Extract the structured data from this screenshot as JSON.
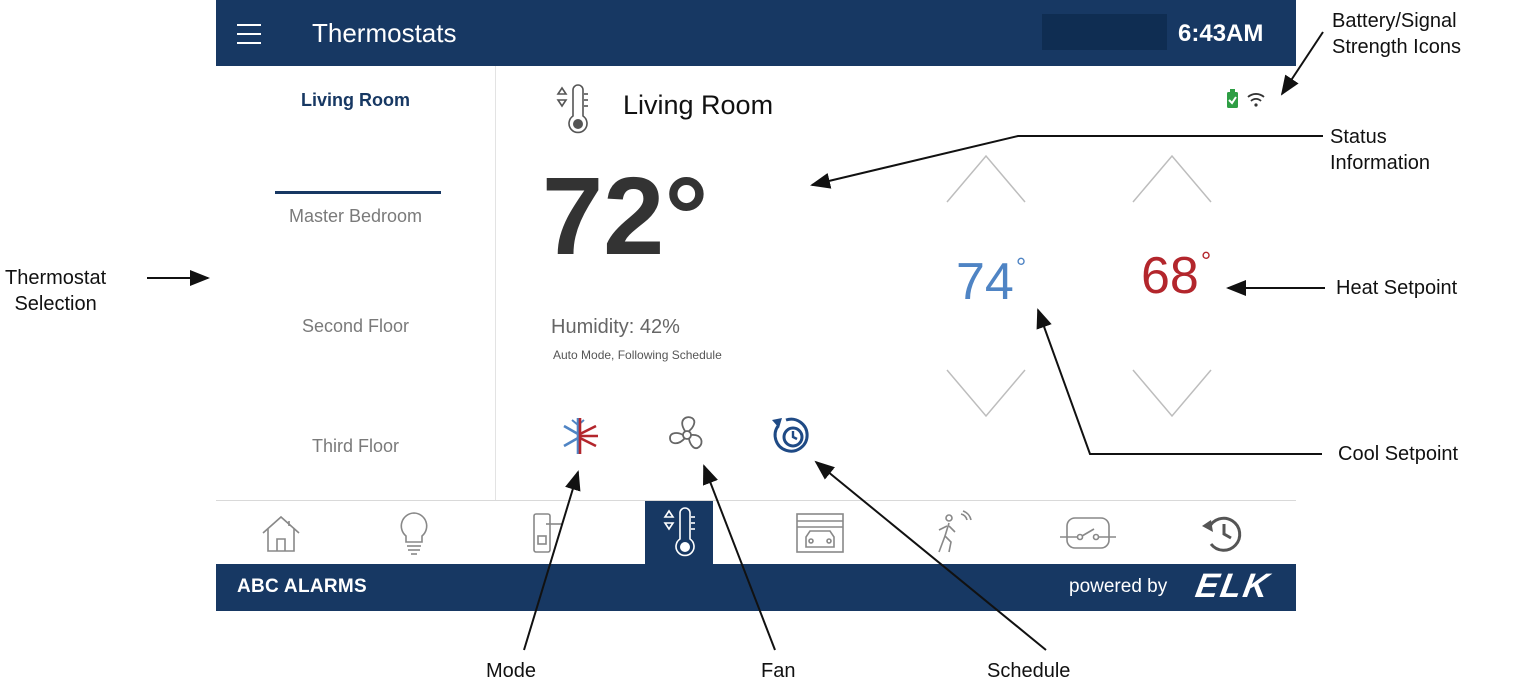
{
  "header": {
    "title": "Thermostats",
    "time": "6:43AM"
  },
  "thermostats": [
    "Living Room",
    "Master Bedroom",
    "Second Floor",
    "Third Floor"
  ],
  "zone": {
    "name": "Living Room",
    "temperature": "72°",
    "humidity": "Humidity: 42%",
    "mode_line": "Auto Mode, Following Schedule",
    "cool_setpoint": "74",
    "heat_setpoint": "68",
    "degree_symbol": "°"
  },
  "status_icons": [
    "battery-icon",
    "wifi-signal-icon"
  ],
  "controls": [
    "mode-icon",
    "fan-icon",
    "schedule-icon"
  ],
  "nav": [
    "home-icon",
    "lightbulb-icon",
    "door-lock-icon",
    "thermostat-icon",
    "garage-icon",
    "motion-sensor-icon",
    "switch-icon",
    "history-icon"
  ],
  "nav_active_index": 3,
  "footer": {
    "brand": "ABC ALARMS",
    "powered_by": "powered by",
    "logo": "ELK"
  },
  "callouts": {
    "battery_signal": [
      "Battery/Signal",
      "Strength Icons"
    ],
    "status_information": [
      "Status",
      "Information"
    ],
    "heat_setpoint": "Heat Setpoint",
    "cool_setpoint": "Cool Setpoint",
    "thermostat_selection": [
      "Thermostat",
      "Selection"
    ],
    "mode": "Mode",
    "fan": "Fan",
    "schedule": "Schedule"
  },
  "colors": {
    "primary": "#173863",
    "cool": "#4f84c4",
    "heat": "#b3262c",
    "battery_ok": "#2e9e44"
  }
}
